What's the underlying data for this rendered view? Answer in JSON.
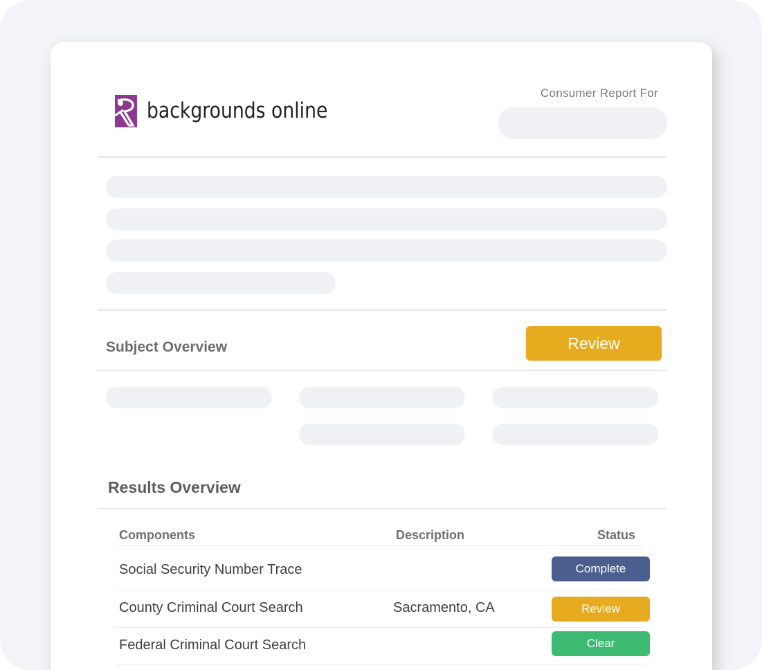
{
  "brand": {
    "name": "backgrounds online",
    "mark_color": "#8b3a8f"
  },
  "header": {
    "report_label": "Consumer Report For"
  },
  "subject_overview": {
    "title": "Subject Overview",
    "review_label": "Review",
    "review_color": "#e6ab1f"
  },
  "results_overview": {
    "title": "Results Overview",
    "columns": [
      "Components",
      "Description",
      "Status"
    ],
    "rows": [
      {
        "component": "Social Security Number Trace",
        "description": "",
        "status": "Complete",
        "status_color": "#4a5f8f"
      },
      {
        "component": "County Criminal Court Search",
        "description": "Sacramento, CA",
        "status": "Review",
        "status_color": "#e6ab1f"
      },
      {
        "component": "Federal Criminal Court Search",
        "description": "",
        "status": "Clear",
        "status_color": "#3dbb72"
      }
    ]
  }
}
